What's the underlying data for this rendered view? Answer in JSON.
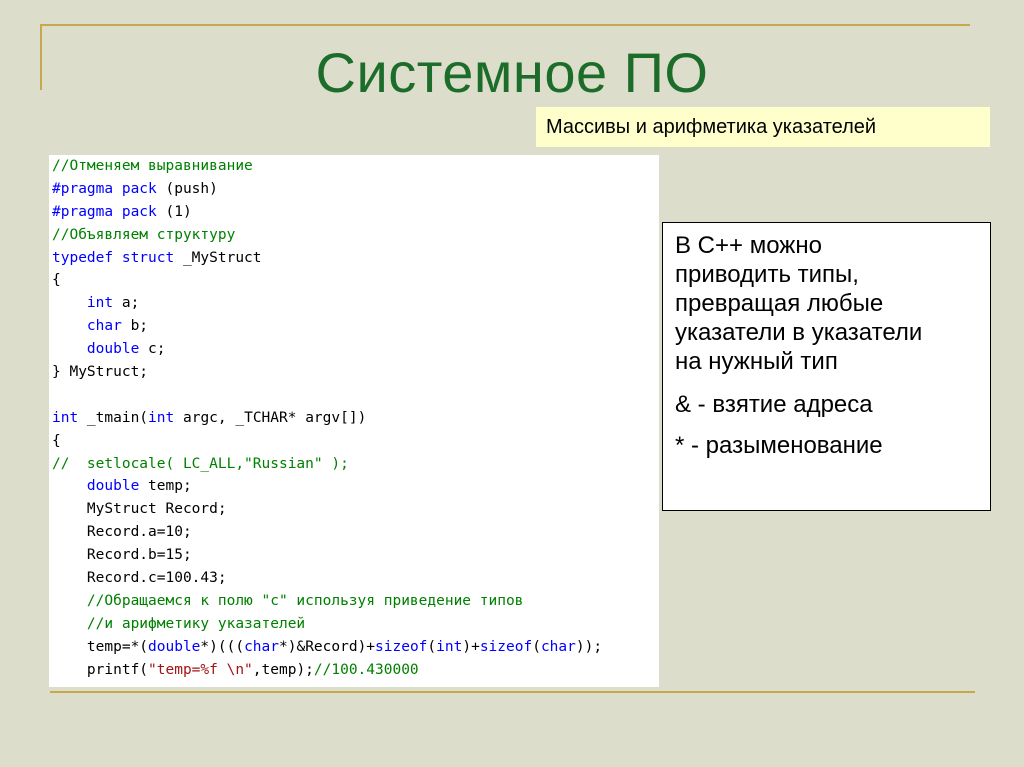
{
  "slide": {
    "title": "Системное ПО",
    "subtitle": "Массивы и арифметика указателей"
  },
  "code": {
    "lines": [
      [
        {
          "t": "//Отменяем выравнивание",
          "c": "comment"
        }
      ],
      [
        {
          "t": "#pragma pack",
          "c": "kw"
        },
        {
          "t": " (push)",
          "c": "plain"
        }
      ],
      [
        {
          "t": "#pragma pack",
          "c": "kw"
        },
        {
          "t": " (1)",
          "c": "plain"
        }
      ],
      [
        {
          "t": "//Объявляем структуру",
          "c": "comment"
        }
      ],
      [
        {
          "t": "typedef struct",
          "c": "kw"
        },
        {
          "t": " _MyStruct",
          "c": "plain"
        }
      ],
      [
        {
          "t": "{",
          "c": "plain"
        }
      ],
      [
        {
          "t": "    ",
          "c": "plain"
        },
        {
          "t": "int",
          "c": "kw"
        },
        {
          "t": " a;",
          "c": "plain"
        }
      ],
      [
        {
          "t": "    ",
          "c": "plain"
        },
        {
          "t": "char",
          "c": "kw"
        },
        {
          "t": " b;",
          "c": "plain"
        }
      ],
      [
        {
          "t": "    ",
          "c": "plain"
        },
        {
          "t": "double",
          "c": "kw"
        },
        {
          "t": " c;",
          "c": "plain"
        }
      ],
      [
        {
          "t": "} MyStruct;",
          "c": "plain"
        }
      ],
      [],
      [
        {
          "t": "int",
          "c": "kw"
        },
        {
          "t": " _tmain(",
          "c": "plain"
        },
        {
          "t": "int",
          "c": "kw"
        },
        {
          "t": " argc, _TCHAR* argv[])",
          "c": "plain"
        }
      ],
      [
        {
          "t": "{",
          "c": "plain"
        }
      ],
      [
        {
          "t": "//  setlocale( LC_ALL,\"Russian\" );",
          "c": "comment"
        }
      ],
      [
        {
          "t": "    ",
          "c": "plain"
        },
        {
          "t": "double",
          "c": "kw"
        },
        {
          "t": " temp;",
          "c": "plain"
        }
      ],
      [
        {
          "t": "    MyStruct Record;",
          "c": "plain"
        }
      ],
      [
        {
          "t": "    Record.a=10;",
          "c": "plain"
        }
      ],
      [
        {
          "t": "    Record.b=15;",
          "c": "plain"
        }
      ],
      [
        {
          "t": "    Record.c=100.43;",
          "c": "plain"
        }
      ],
      [
        {
          "t": "    //Обращаемся к полю \"c\" используя приведение типов",
          "c": "comment"
        }
      ],
      [
        {
          "t": "    //и арифметику указателей",
          "c": "comment"
        }
      ],
      [
        {
          "t": "    temp=*(",
          "c": "plain"
        },
        {
          "t": "double",
          "c": "kw"
        },
        {
          "t": "*)(((",
          "c": "plain"
        },
        {
          "t": "char",
          "c": "kw"
        },
        {
          "t": "*)&Record)+",
          "c": "plain"
        },
        {
          "t": "sizeof",
          "c": "kw"
        },
        {
          "t": "(",
          "c": "plain"
        },
        {
          "t": "int",
          "c": "kw"
        },
        {
          "t": ")+",
          "c": "plain"
        },
        {
          "t": "sizeof",
          "c": "kw"
        },
        {
          "t": "(",
          "c": "plain"
        },
        {
          "t": "char",
          "c": "kw"
        },
        {
          "t": "));",
          "c": "plain"
        }
      ],
      [
        {
          "t": "    printf(",
          "c": "plain"
        },
        {
          "t": "\"temp=%f \\n\"",
          "c": "str"
        },
        {
          "t": ",temp);",
          "c": "plain"
        },
        {
          "t": "//100.430000",
          "c": "comment"
        }
      ]
    ]
  },
  "note": {
    "lines": [
      "В С++ можно",
      "приводить типы,",
      "превращая любые",
      "указатели в указатели",
      "на нужный тип"
    ],
    "address": "& - взятие адреса",
    "deref": "* - разыменование"
  },
  "colors": {
    "background": "#ddddcc",
    "title": "#1d6d2a",
    "rule": "#c7a94d",
    "subtitle_bg": "#ffffcc",
    "code_keyword": "#0000ff",
    "code_comment": "#008000",
    "code_string": "#a31515"
  }
}
